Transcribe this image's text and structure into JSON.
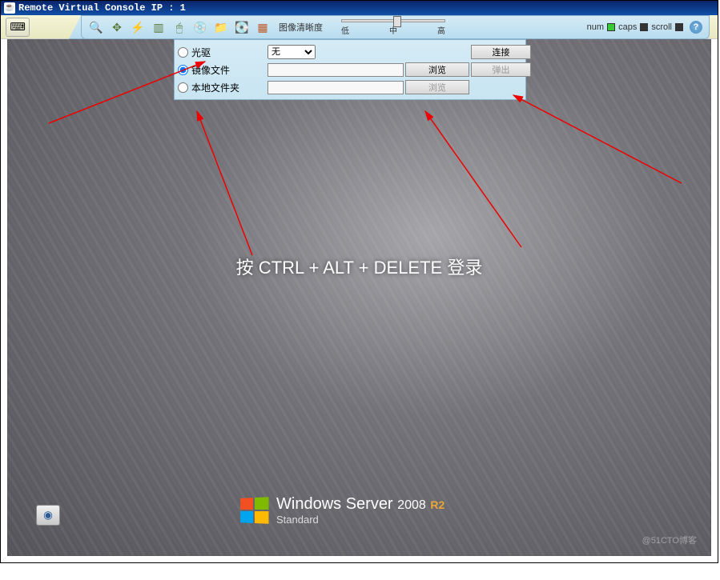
{
  "titlebar": {
    "text": "Remote Virtual Console   IP : 1"
  },
  "toolbar": {
    "clarity_label": "图像清晰度",
    "slider": {
      "low": "低",
      "mid": "中",
      "high": "高"
    },
    "indicators": {
      "num": "num",
      "caps": "caps",
      "scroll": "scroll"
    },
    "help": "?"
  },
  "mount_panel": {
    "rows": [
      {
        "id": "optical",
        "label": "光驱",
        "dropdown_selected": "无",
        "btn1": "",
        "btn2": "连接"
      },
      {
        "id": "image",
        "label": "镜像文件",
        "btn1": "浏览",
        "btn2": "弹出"
      },
      {
        "id": "local",
        "label": "本地文件夹",
        "btn1": "浏览",
        "btn2": ""
      }
    ]
  },
  "login_prompt": "按 CTRL + ALT + DELETE 登录",
  "winlogo": {
    "title_a": "Windows Server",
    "year": "2008",
    "r2": "R2",
    "edition": "Standard"
  },
  "watermark": "@51CTO博客"
}
